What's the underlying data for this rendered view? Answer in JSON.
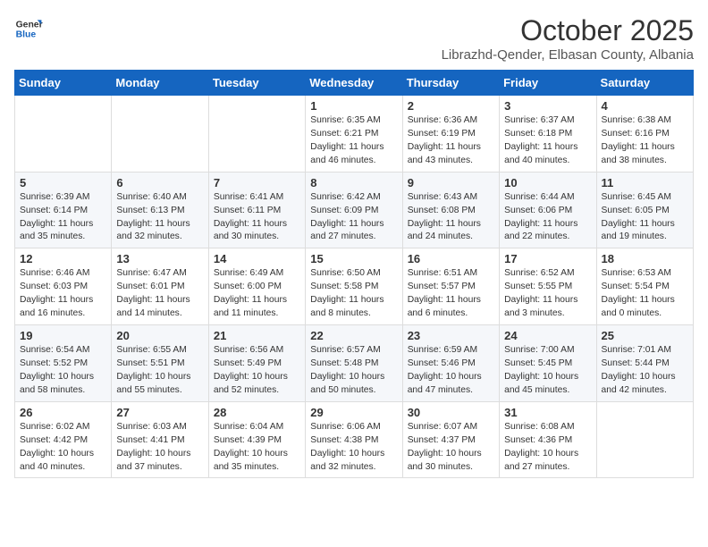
{
  "logo": {
    "line1": "General",
    "line2": "Blue"
  },
  "title": "October 2025",
  "subtitle": "Librazhd-Qender, Elbasan County, Albania",
  "days_of_week": [
    "Sunday",
    "Monday",
    "Tuesday",
    "Wednesday",
    "Thursday",
    "Friday",
    "Saturday"
  ],
  "weeks": [
    [
      {
        "day": "",
        "info": ""
      },
      {
        "day": "",
        "info": ""
      },
      {
        "day": "",
        "info": ""
      },
      {
        "day": "1",
        "info": "Sunrise: 6:35 AM\nSunset: 6:21 PM\nDaylight: 11 hours\nand 46 minutes."
      },
      {
        "day": "2",
        "info": "Sunrise: 6:36 AM\nSunset: 6:19 PM\nDaylight: 11 hours\nand 43 minutes."
      },
      {
        "day": "3",
        "info": "Sunrise: 6:37 AM\nSunset: 6:18 PM\nDaylight: 11 hours\nand 40 minutes."
      },
      {
        "day": "4",
        "info": "Sunrise: 6:38 AM\nSunset: 6:16 PM\nDaylight: 11 hours\nand 38 minutes."
      }
    ],
    [
      {
        "day": "5",
        "info": "Sunrise: 6:39 AM\nSunset: 6:14 PM\nDaylight: 11 hours\nand 35 minutes."
      },
      {
        "day": "6",
        "info": "Sunrise: 6:40 AM\nSunset: 6:13 PM\nDaylight: 11 hours\nand 32 minutes."
      },
      {
        "day": "7",
        "info": "Sunrise: 6:41 AM\nSunset: 6:11 PM\nDaylight: 11 hours\nand 30 minutes."
      },
      {
        "day": "8",
        "info": "Sunrise: 6:42 AM\nSunset: 6:09 PM\nDaylight: 11 hours\nand 27 minutes."
      },
      {
        "day": "9",
        "info": "Sunrise: 6:43 AM\nSunset: 6:08 PM\nDaylight: 11 hours\nand 24 minutes."
      },
      {
        "day": "10",
        "info": "Sunrise: 6:44 AM\nSunset: 6:06 PM\nDaylight: 11 hours\nand 22 minutes."
      },
      {
        "day": "11",
        "info": "Sunrise: 6:45 AM\nSunset: 6:05 PM\nDaylight: 11 hours\nand 19 minutes."
      }
    ],
    [
      {
        "day": "12",
        "info": "Sunrise: 6:46 AM\nSunset: 6:03 PM\nDaylight: 11 hours\nand 16 minutes."
      },
      {
        "day": "13",
        "info": "Sunrise: 6:47 AM\nSunset: 6:01 PM\nDaylight: 11 hours\nand 14 minutes."
      },
      {
        "day": "14",
        "info": "Sunrise: 6:49 AM\nSunset: 6:00 PM\nDaylight: 11 hours\nand 11 minutes."
      },
      {
        "day": "15",
        "info": "Sunrise: 6:50 AM\nSunset: 5:58 PM\nDaylight: 11 hours\nand 8 minutes."
      },
      {
        "day": "16",
        "info": "Sunrise: 6:51 AM\nSunset: 5:57 PM\nDaylight: 11 hours\nand 6 minutes."
      },
      {
        "day": "17",
        "info": "Sunrise: 6:52 AM\nSunset: 5:55 PM\nDaylight: 11 hours\nand 3 minutes."
      },
      {
        "day": "18",
        "info": "Sunrise: 6:53 AM\nSunset: 5:54 PM\nDaylight: 11 hours\nand 0 minutes."
      }
    ],
    [
      {
        "day": "19",
        "info": "Sunrise: 6:54 AM\nSunset: 5:52 PM\nDaylight: 10 hours\nand 58 minutes."
      },
      {
        "day": "20",
        "info": "Sunrise: 6:55 AM\nSunset: 5:51 PM\nDaylight: 10 hours\nand 55 minutes."
      },
      {
        "day": "21",
        "info": "Sunrise: 6:56 AM\nSunset: 5:49 PM\nDaylight: 10 hours\nand 52 minutes."
      },
      {
        "day": "22",
        "info": "Sunrise: 6:57 AM\nSunset: 5:48 PM\nDaylight: 10 hours\nand 50 minutes."
      },
      {
        "day": "23",
        "info": "Sunrise: 6:59 AM\nSunset: 5:46 PM\nDaylight: 10 hours\nand 47 minutes."
      },
      {
        "day": "24",
        "info": "Sunrise: 7:00 AM\nSunset: 5:45 PM\nDaylight: 10 hours\nand 45 minutes."
      },
      {
        "day": "25",
        "info": "Sunrise: 7:01 AM\nSunset: 5:44 PM\nDaylight: 10 hours\nand 42 minutes."
      }
    ],
    [
      {
        "day": "26",
        "info": "Sunrise: 6:02 AM\nSunset: 4:42 PM\nDaylight: 10 hours\nand 40 minutes."
      },
      {
        "day": "27",
        "info": "Sunrise: 6:03 AM\nSunset: 4:41 PM\nDaylight: 10 hours\nand 37 minutes."
      },
      {
        "day": "28",
        "info": "Sunrise: 6:04 AM\nSunset: 4:39 PM\nDaylight: 10 hours\nand 35 minutes."
      },
      {
        "day": "29",
        "info": "Sunrise: 6:06 AM\nSunset: 4:38 PM\nDaylight: 10 hours\nand 32 minutes."
      },
      {
        "day": "30",
        "info": "Sunrise: 6:07 AM\nSunset: 4:37 PM\nDaylight: 10 hours\nand 30 minutes."
      },
      {
        "day": "31",
        "info": "Sunrise: 6:08 AM\nSunset: 4:36 PM\nDaylight: 10 hours\nand 27 minutes."
      },
      {
        "day": "",
        "info": ""
      }
    ]
  ]
}
